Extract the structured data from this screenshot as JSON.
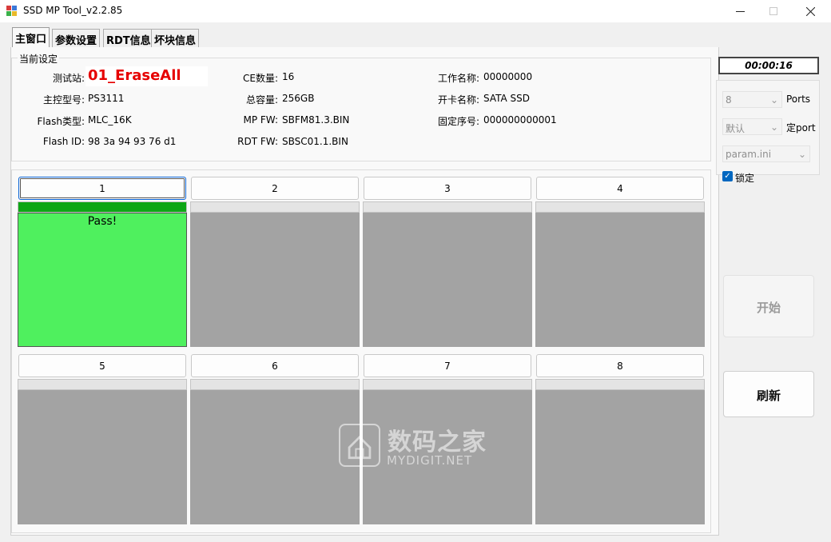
{
  "window": {
    "title": "SSD MP Tool_v2.2.85"
  },
  "tabs": [
    {
      "label": "主窗口"
    },
    {
      "label": "参数设置"
    },
    {
      "label": "RDT信息"
    },
    {
      "label": "坏块信息"
    }
  ],
  "settings": {
    "legend": "当前设定",
    "station_label": "测试站:",
    "station_value": "01_EraseAll",
    "controller_label": "主控型号:",
    "controller_value": "PS3111",
    "flash_type_label": "Flash类型:",
    "flash_type_value": "MLC_16K",
    "flash_id_label": "Flash ID:",
    "flash_id_value": "98 3a 94 93 76 d1",
    "ce_count_label": "CE数量:",
    "ce_count_value": "16",
    "capacity_label": "总容量:",
    "capacity_value": "256GB",
    "mp_fw_label": "MP FW:",
    "mp_fw_value": "SBFM81.3.BIN",
    "rdt_fw_label": "RDT FW:",
    "rdt_fw_value": "SBSC01.1.BIN",
    "work_name_label": "工作名称:",
    "work_name_value": "00000000",
    "card_name_label": "开卡名称:",
    "card_name_value": "SATA SSD",
    "serial_label": "固定序号:",
    "serial_value": "000000000001"
  },
  "ports": [
    {
      "label": "1",
      "status": "Pass!",
      "progress": 1.0
    },
    {
      "label": "2",
      "status": "",
      "progress": 0
    },
    {
      "label": "3",
      "status": "",
      "progress": 0
    },
    {
      "label": "4",
      "status": "",
      "progress": 0
    },
    {
      "label": "5",
      "status": "",
      "progress": 0
    },
    {
      "label": "6",
      "status": "",
      "progress": 0
    },
    {
      "label": "7",
      "status": "",
      "progress": 0
    },
    {
      "label": "8",
      "status": "",
      "progress": 0
    }
  ],
  "timer": "00:00:16",
  "controls": {
    "ports_value": "8",
    "ports_label": "Ports",
    "mode_value": "默认",
    "mode_label": "定port",
    "param_file": "param.ini",
    "lock_label": "锁定",
    "lock_checked": true
  },
  "buttons": {
    "start_label": "开始",
    "refresh_label": "刷新"
  },
  "watermark": {
    "cn": "数码之家",
    "en": "MYDIGIT.NET"
  },
  "colors": {
    "station_red": "#e60000",
    "pass_green": "#4ff05e",
    "progress_green": "#0ea615",
    "idle_gray": "#a3a3a3"
  }
}
